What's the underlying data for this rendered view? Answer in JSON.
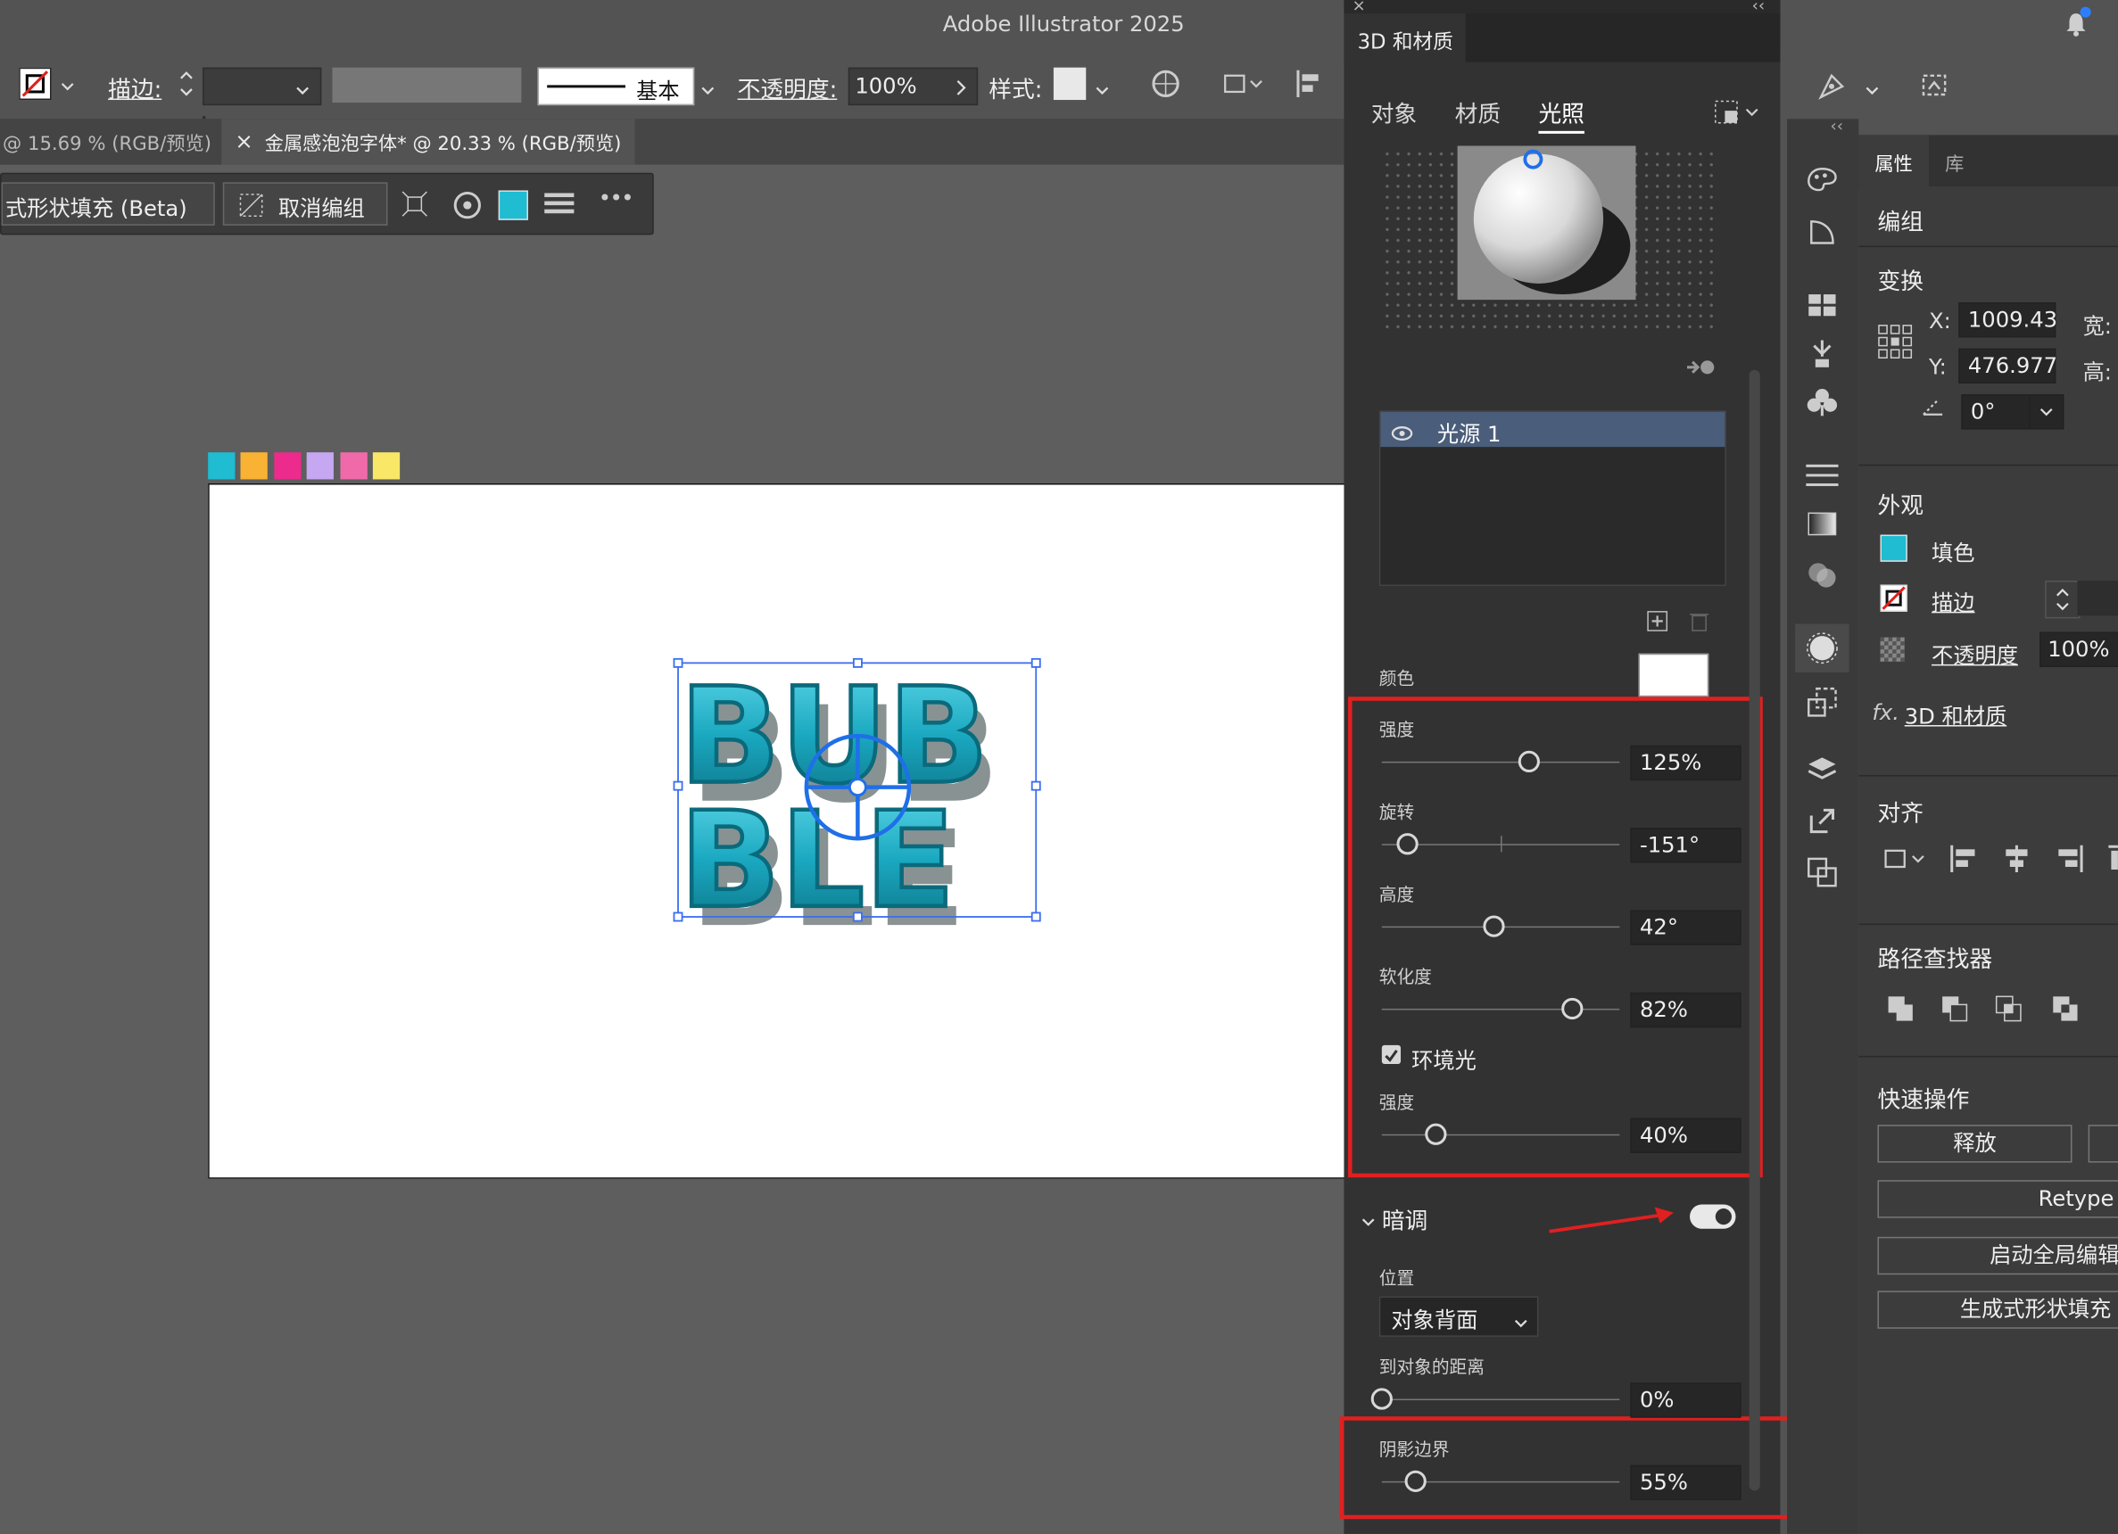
{
  "app_title": "Adobe Illustrator 2025",
  "control_bar": {
    "stroke_label": "描边:",
    "stroke_style": "基本",
    "opacity_label": "不透明度:",
    "opacity_value": "100%",
    "style_label": "样式:"
  },
  "doc_tabs": [
    {
      "label": "@ 15.69 % (RGB/预览)"
    },
    {
      "close": "×",
      "label": "金属感泡泡字体* @ 20.33 % (RGB/预览)"
    }
  ],
  "context_bar": {
    "gen_fill": "式形状填充 (Beta)",
    "ungroup": "取消编组",
    "more": "•••"
  },
  "artwork_text": "BUBBLE",
  "swatches": [
    "#1fbcd2",
    "#f9b233",
    "#ec2b8c",
    "#c6a7f2",
    "#f06aa9",
    "#f9e768"
  ],
  "panel_3d": {
    "title": "3D 和材质",
    "tabs": [
      "对象",
      "材质",
      "光照"
    ],
    "light_list": [
      "光源 1"
    ],
    "color_label": "颜色",
    "color_value": "#ffffff",
    "sliders": [
      {
        "label": "强度",
        "value": "125%",
        "fraction": 0.62
      },
      {
        "label": "旋转",
        "value": "-151°",
        "fraction": 0.11
      },
      {
        "label": "高度",
        "value": "42°",
        "fraction": 0.47
      },
      {
        "label": "软化度",
        "value": "82%",
        "fraction": 0.8
      }
    ],
    "ambient_label": "环境光",
    "ambient_checked": true,
    "ambient_intensity": {
      "label": "强度",
      "value": "40%",
      "fraction": 0.23
    },
    "shadow_section": "暗调",
    "shadow_on": true,
    "position_label": "位置",
    "position_value": "对象背面",
    "distance": {
      "label": "到对象的距离",
      "value": "0%",
      "fraction": 0.0
    },
    "shadow_bound": {
      "label": "阴影边界",
      "value": "55%",
      "fraction": 0.14
    }
  },
  "properties": {
    "tabs": [
      "属性",
      "库"
    ],
    "group_label": "编组",
    "transform_header": "变换",
    "x_label": "X:",
    "x_value": "1009.43",
    "y_label": "Y:",
    "y_value": "476.977",
    "w_label": "宽:",
    "h_label": "高:",
    "angle_value": "0°",
    "appearance_header": "外观",
    "fill_label": "填色",
    "fill_color": "#1fbcd2",
    "stroke_label": "描边",
    "opacity_label": "不透明度",
    "opacity_value": "100%",
    "fx_label": "3D 和材质",
    "align_header": "对齐",
    "pathfinder_header": "路径查找器",
    "quick_header": "快速操作",
    "quick_buttons": [
      "释放",
      "Retype",
      "启动全局编辑",
      "生成式形状填充"
    ]
  }
}
